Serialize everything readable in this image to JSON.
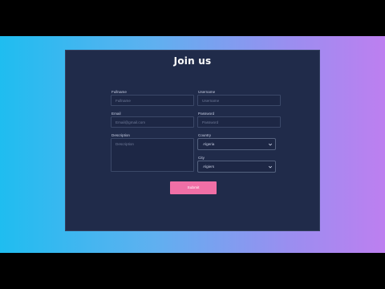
{
  "form": {
    "title": "Join us",
    "fullname": {
      "label": "Fullname",
      "placeholder": "Fullname"
    },
    "username": {
      "label": "Username",
      "placeholder": "Username"
    },
    "email": {
      "label": "Email",
      "placeholder": "Email@gmail.com"
    },
    "password": {
      "label": "Password",
      "placeholder": "Password"
    },
    "description": {
      "label": "Description",
      "placeholder": "Description"
    },
    "country": {
      "label": "Country",
      "value": "Algeria"
    },
    "city": {
      "label": "City",
      "value": "Algiers"
    },
    "submit_label": "Submit"
  },
  "colors": {
    "card_background": "#202b4a",
    "submit_button": "#f06fa6",
    "gradient_left": "#1fbdf0",
    "gradient_right": "#bd7ff0"
  },
  "icons": {
    "select_indicator": "chevron-down-icon"
  }
}
